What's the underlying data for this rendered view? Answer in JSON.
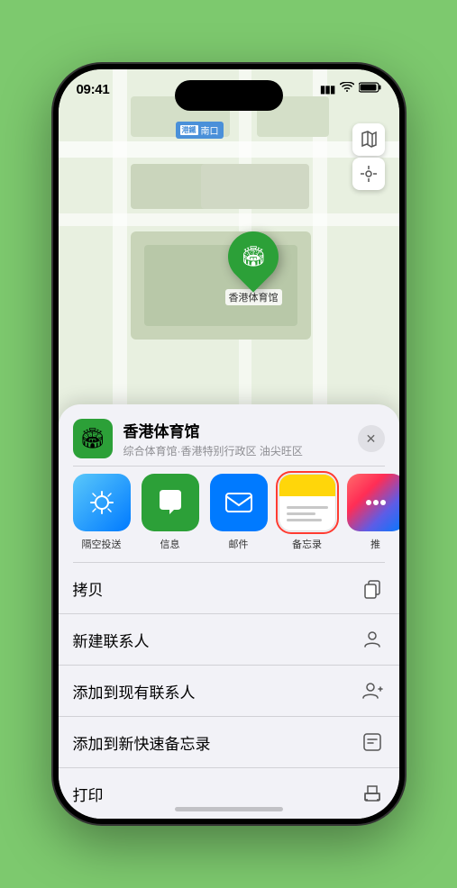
{
  "status": {
    "time": "09:41",
    "signal_icon": "▲▲▲",
    "wifi_icon": "wifi",
    "battery_icon": "battery"
  },
  "map": {
    "station_label": "南口",
    "pin_label": "香港体育馆"
  },
  "sheet": {
    "venue_icon": "🏟",
    "venue_name": "香港体育馆",
    "venue_sub": "综合体育馆·香港特别行政区 油尖旺区",
    "close_label": "✕",
    "share_items": [
      {
        "id": "airdrop",
        "label": "隔空投送",
        "icon": "📶"
      },
      {
        "id": "messages",
        "label": "信息",
        "icon": "💬"
      },
      {
        "id": "mail",
        "label": "邮件",
        "icon": "✉"
      },
      {
        "id": "notes",
        "label": "备忘录",
        "icon": "notes"
      },
      {
        "id": "more",
        "label": "推",
        "icon": "⋯"
      }
    ],
    "actions": [
      {
        "id": "copy",
        "label": "拷贝",
        "icon": "📋"
      },
      {
        "id": "new-contact",
        "label": "新建联系人",
        "icon": "👤"
      },
      {
        "id": "add-to-contact",
        "label": "添加到现有联系人",
        "icon": "👤+"
      },
      {
        "id": "add-to-notes",
        "label": "添加到新快速备忘录",
        "icon": "📝"
      },
      {
        "id": "print",
        "label": "打印",
        "icon": "🖨"
      }
    ]
  }
}
